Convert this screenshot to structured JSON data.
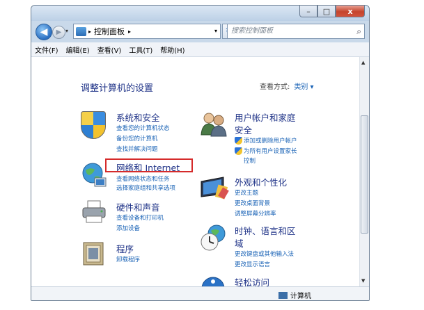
{
  "window": {
    "caption": {
      "min": "–",
      "max": "□",
      "close": "x"
    }
  },
  "nav": {
    "back_glyph": "◀",
    "forward_glyph": "▶",
    "breadcrumb": [
      "控制面板"
    ],
    "sep": "▸",
    "dropdown": "▾",
    "refresh_glyph": "↻",
    "search_placeholder": "搜索控制面板",
    "search_glyph": "⌕"
  },
  "menubar": [
    "文件(F)",
    "编辑(E)",
    "查看(V)",
    "工具(T)",
    "帮助(H)"
  ],
  "content": {
    "heading": "调整计算机的设置",
    "view_by_label": "查看方式:",
    "view_by_value": "类别 ▾",
    "categories": [
      {
        "title": "系统和安全",
        "links": [
          "查看您的计算机状态",
          "备份您的计算机",
          "查找并解决问题"
        ]
      },
      {
        "title": "网络和 Internet",
        "links": [
          "查看网络状态和任务",
          "选择家庭组和共享选项"
        ]
      },
      {
        "title": "硬件和声音",
        "links": [
          "查看设备和打印机",
          "添加设备"
        ]
      },
      {
        "title": "程序",
        "links": [
          "卸载程序"
        ]
      },
      {
        "title": "用户帐户和家庭",
        "title2": "安全",
        "links": [
          "添加或删除用户帐户",
          "为所有用户设置家长",
          "控制"
        ]
      },
      {
        "title": "外观和个性化",
        "links": [
          "更改主题",
          "更改桌面背景",
          "调整屏幕分辨率"
        ]
      },
      {
        "title": "时钟、语言和区",
        "title2": "域",
        "links": [
          "更改键盘或其他输入法",
          "更改显示语言"
        ]
      },
      {
        "title": "轻松访问",
        "links": []
      }
    ]
  },
  "status": {
    "computer": "计算机"
  },
  "scroll": {
    "up": "▲",
    "down": "▼"
  },
  "colors": {
    "highlight_box": "#d52b2b",
    "link": "#1a63b6",
    "category_title": "#1e3287"
  }
}
